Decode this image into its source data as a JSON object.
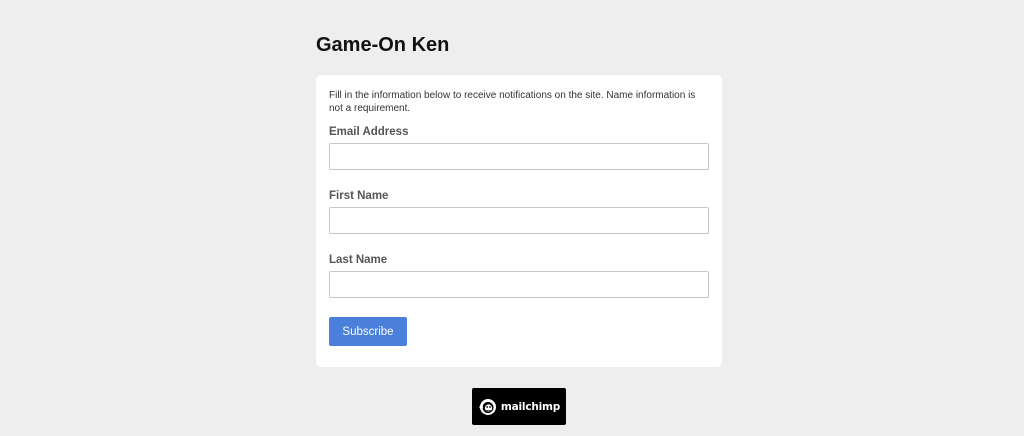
{
  "header": {
    "title": "Game-On Ken"
  },
  "form": {
    "intro": "Fill in the information below to receive notifications on the site.  Name information is not a requirement.",
    "fields": [
      {
        "label": "Email Address",
        "value": "",
        "placeholder": ""
      },
      {
        "label": "First Name",
        "value": "",
        "placeholder": ""
      },
      {
        "label": "Last Name",
        "value": "",
        "placeholder": ""
      }
    ],
    "submit_label": "Subscribe"
  },
  "footer": {
    "brand_logo": "mailchimp",
    "brand_icon": "freddie-chimp-icon"
  },
  "colors": {
    "background": "#eeeeee",
    "card": "#ffffff",
    "button": "#4a7fdb",
    "badge": "#000000"
  }
}
